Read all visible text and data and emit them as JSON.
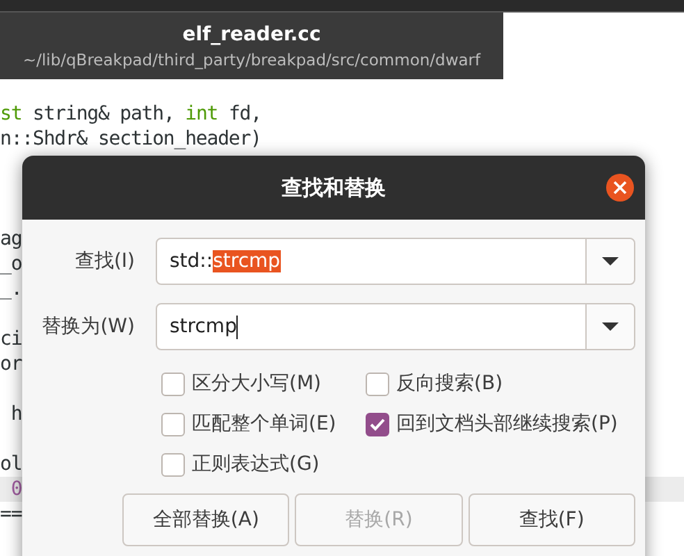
{
  "window": {
    "title": "elf_reader.cc",
    "subtitle": "~/lib/qBreakpad/third_party/breakpad/src/common/dwarf"
  },
  "editor": {
    "lines": [
      {
        "current": false,
        "tokens": [
          {
            "kind": "keyword",
            "text": "st"
          },
          {
            "kind": "plain",
            "text": " string& path, "
          },
          {
            "kind": "keyword",
            "text": "int"
          },
          {
            "kind": "plain",
            "text": " fd,"
          }
        ]
      },
      {
        "current": false,
        "tokens": [
          {
            "kind": "plain",
            "text": "n::Shdr& section_header)"
          }
        ]
      },
      {
        "current": false
      },
      {
        "current": false
      },
      {
        "current": false
      },
      {
        "current": false,
        "tokens": [
          {
            "kind": "plain",
            "text": "ag"
          }
        ]
      },
      {
        "current": false,
        "tokens": [
          {
            "kind": "plain",
            "text": "_o"
          }
        ]
      },
      {
        "current": false,
        "tokens": [
          {
            "kind": "plain",
            "text": "_."
          }
        ]
      },
      {
        "current": false
      },
      {
        "current": false,
        "tokens": [
          {
            "kind": "plain",
            "text": "ci"
          }
        ]
      },
      {
        "current": false,
        "tokens": [
          {
            "kind": "plain",
            "text": "or"
          }
        ]
      },
      {
        "current": false
      },
      {
        "current": false,
        "tokens": [
          {
            "kind": "plain",
            "text": " h"
          }
        ]
      },
      {
        "current": false
      },
      {
        "current": false,
        "tokens": [
          {
            "kind": "plain",
            "text": "ol"
          }
        ]
      },
      {
        "current": true,
        "tokens": [
          {
            "kind": "number",
            "text": " 0"
          }
        ]
      },
      {
        "current": false,
        "tokens": [
          {
            "kind": "plain",
            "text": "=="
          }
        ]
      }
    ]
  },
  "dialog": {
    "title": "查找和替换",
    "fields": [
      {
        "label": "查找(I)",
        "caret": false,
        "value": [
          {
            "text": "std::",
            "selected": false
          },
          {
            "text": "strcmp",
            "selected": true
          }
        ]
      },
      {
        "label": "替换为(W)",
        "caret": true,
        "value": [
          {
            "text": "strcmp",
            "selected": false
          }
        ]
      }
    ],
    "options": [
      {
        "label": "区分大小写(M)",
        "checked": false
      },
      {
        "label": "反向搜索(B)",
        "checked": false
      },
      {
        "label": "匹配整个单词(E)",
        "checked": false
      },
      {
        "label": "回到文档头部继续搜索(P)",
        "checked": true
      },
      {
        "label": "正则表达式(G)",
        "checked": false
      }
    ],
    "buttons": [
      {
        "label": "全部替换(A)",
        "disabled": false
      },
      {
        "label": "替换(R)",
        "disabled": true
      },
      {
        "label": "查找(F)",
        "disabled": false
      }
    ]
  }
}
